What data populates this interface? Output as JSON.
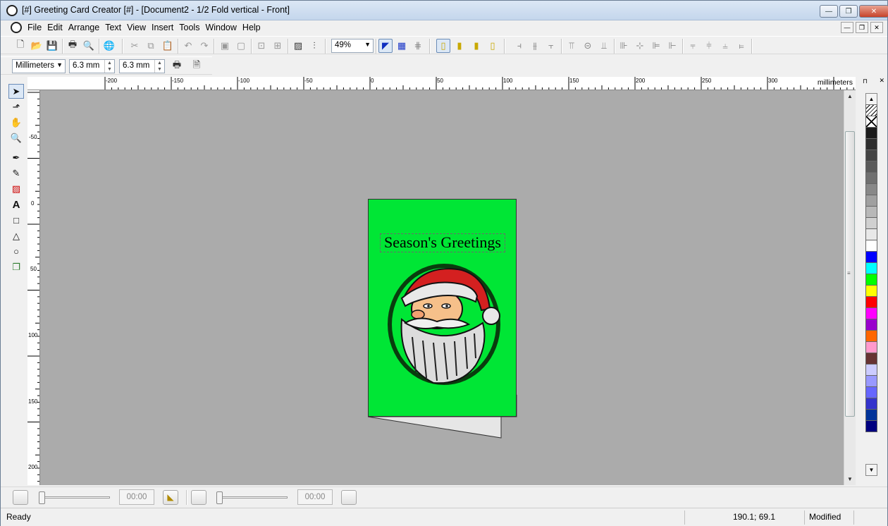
{
  "window": {
    "title": "[#] Greeting Card Creator [#] - [Document2 - 1/2 Fold vertical - Front]",
    "minimize_label": "—",
    "maximize_label": "❐",
    "close_label": "✕"
  },
  "menu": {
    "items": [
      "File",
      "Edit",
      "Arrange",
      "Text",
      "View",
      "Insert",
      "Tools",
      "Window",
      "Help"
    ]
  },
  "toolbar": {
    "zoom_value": "49%"
  },
  "units_toolbar": {
    "units_value": "Millimeters",
    "nudge_x": "6.3 mm",
    "nudge_y": "6.3 mm"
  },
  "ruler": {
    "units_label": "millimeters",
    "h_ticks": [
      "-200",
      "-150",
      "-100",
      "-50",
      "0",
      "50",
      "100",
      "150",
      "200",
      "250",
      "300"
    ],
    "v_ticks": [
      "-50",
      "0",
      "50",
      "100",
      "150",
      "200"
    ]
  },
  "card": {
    "text": "Season's Greetings",
    "background": "#00e635",
    "image": "santa-clause-clipart"
  },
  "palette": {
    "swatches": [
      "#ffffff",
      "#000000",
      "#1c1c1c",
      "#2e2e2e",
      "#444444",
      "#5a5a5a",
      "#707070",
      "#888888",
      "#a0a0a0",
      "#b8b8b8",
      "#d0d0d0",
      "#e8e8e8",
      "#ffffff",
      "#0000ff",
      "#00ffff",
      "#00ff00",
      "#ffff00",
      "#ff0000",
      "#ff00ff",
      "#9900cc",
      "#ff6600",
      "#ff99cc",
      "#663333",
      "#ccccff",
      "#9999ff",
      "#6666ff",
      "#3333cc",
      "#003399",
      "#000080"
    ]
  },
  "animation_bar": {
    "time_a": "00:00",
    "time_b": "00:00"
  },
  "status": {
    "text": "Ready",
    "coords": "190.1; 69.1",
    "state": "Modified"
  }
}
